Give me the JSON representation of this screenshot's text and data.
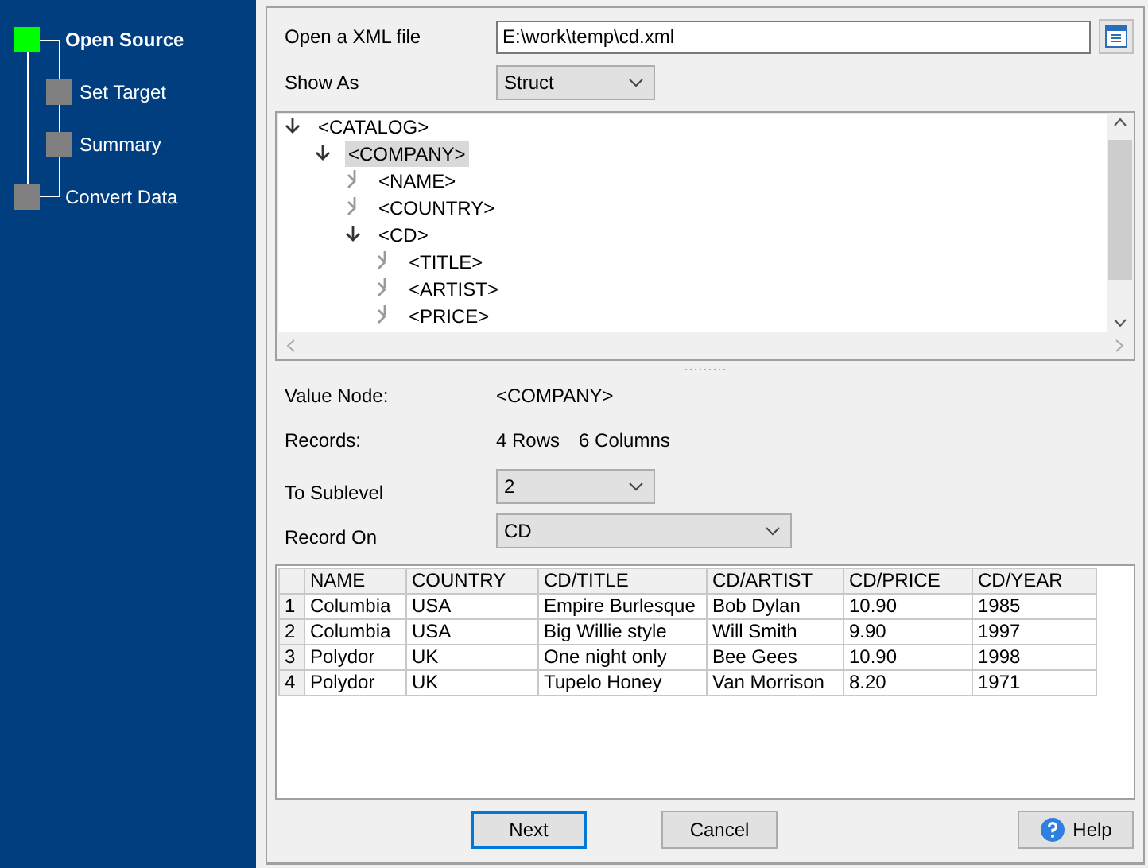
{
  "steps": [
    {
      "label": "Open Source",
      "current": true,
      "children": [
        {
          "label": "Set Target",
          "current": false
        },
        {
          "label": "Summary",
          "current": false
        }
      ]
    },
    {
      "label": "Convert Data",
      "current": false
    }
  ],
  "file": {
    "label": "Open a XML file",
    "value": "E:\\work\\temp\\cd.xml"
  },
  "show_as": {
    "label": "Show As",
    "value": "Struct"
  },
  "tree": [
    {
      "label": "<CATALOG>",
      "expanded": true,
      "selected": false,
      "children": [
        {
          "label": "<COMPANY>",
          "expanded": true,
          "selected": true,
          "children": [
            {
              "label": "<NAME>",
              "expanded": false,
              "selected": false
            },
            {
              "label": "<COUNTRY>",
              "expanded": false,
              "selected": false
            },
            {
              "label": "<CD>",
              "expanded": true,
              "selected": false,
              "children": [
                {
                  "label": "<TITLE>",
                  "expanded": false,
                  "selected": false
                },
                {
                  "label": "<ARTIST>",
                  "expanded": false,
                  "selected": false
                },
                {
                  "label": "<PRICE>",
                  "expanded": false,
                  "selected": false
                }
              ]
            }
          ]
        }
      ]
    }
  ],
  "value_node": {
    "label": "Value Node:",
    "value": "<COMPANY>"
  },
  "records": {
    "label": "Records:",
    "rows": "4 Rows",
    "columns": "6 Columns"
  },
  "sublevel": {
    "label": "To Sublevel",
    "value": "2"
  },
  "record_on": {
    "label": "Record On",
    "value": "CD"
  },
  "table": {
    "columns": [
      "NAME",
      "COUNTRY",
      "CD/TITLE",
      "CD/ARTIST",
      "CD/PRICE",
      "CD/YEAR"
    ],
    "rows": [
      {
        "number": "1",
        "cells": [
          "Columbia",
          "USA",
          "Empire Burlesque",
          "Bob Dylan",
          "10.90",
          "1985"
        ]
      },
      {
        "number": "2",
        "cells": [
          "Columbia",
          "USA",
          "Big Willie style",
          "Will Smith",
          "9.90",
          "1997"
        ]
      },
      {
        "number": "3",
        "cells": [
          "Polydor",
          "UK",
          "One night only",
          "Bee Gees",
          "10.90",
          "1998"
        ]
      },
      {
        "number": "4",
        "cells": [
          "Polydor",
          "UK",
          "Tupelo Honey",
          "Van Morrison",
          "8.20",
          "1971"
        ]
      }
    ]
  },
  "buttons": [
    {
      "label": "Next",
      "kind": "primary"
    },
    {
      "label": "Cancel",
      "kind": "plain"
    },
    {
      "label": "Help",
      "kind": "help"
    }
  ]
}
